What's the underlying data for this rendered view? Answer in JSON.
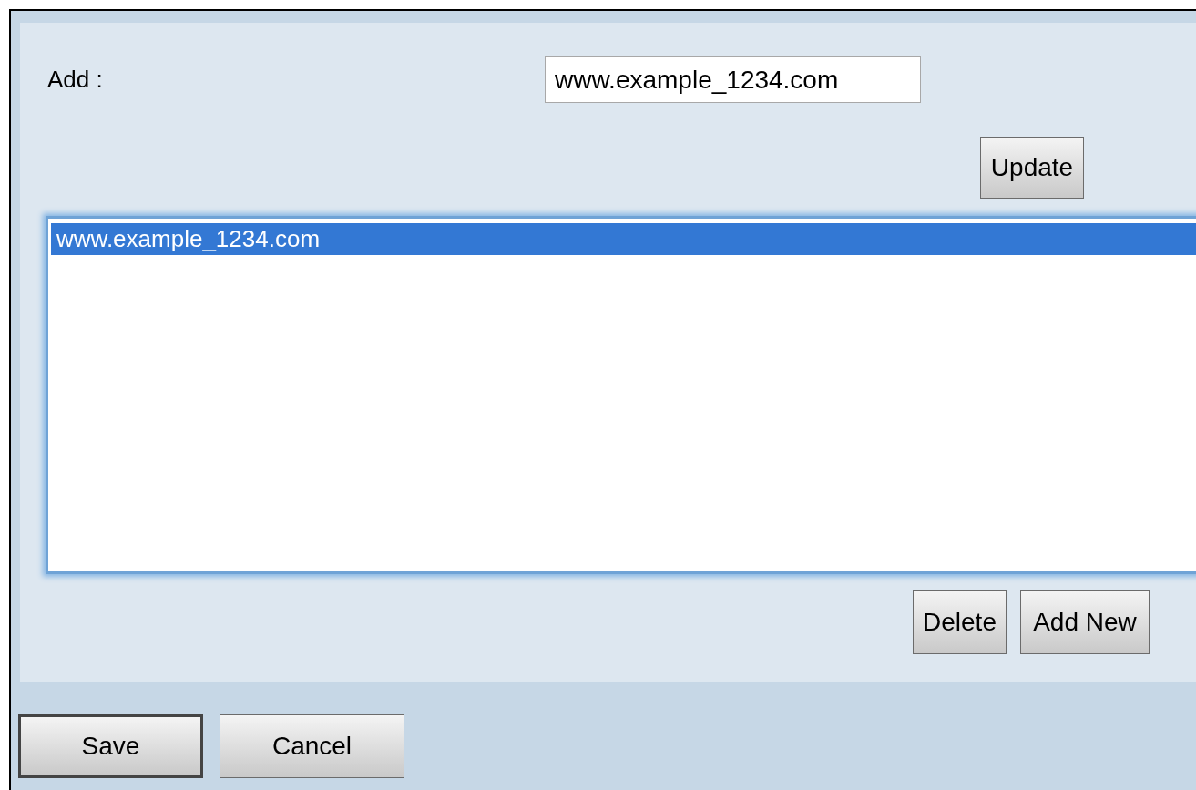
{
  "add": {
    "label": "Add :",
    "value": "www.example_1234.com"
  },
  "update_button": "Update",
  "list": {
    "items": [
      {
        "text": "www.example_1234.com",
        "selected": true
      }
    ]
  },
  "list_buttons": [
    "Delete",
    "Add New"
  ],
  "footer_buttons": [
    {
      "label": "Save",
      "default": true
    },
    {
      "label": "Cancel",
      "default": false
    }
  ]
}
